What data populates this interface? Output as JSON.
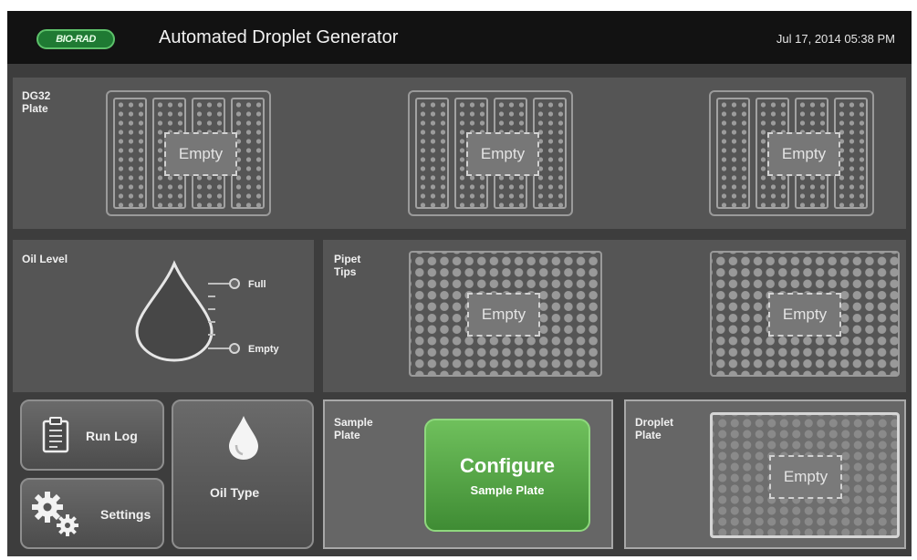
{
  "header": {
    "logo_text": "BIO-RAD",
    "title": "Automated Droplet Generator",
    "datetime": "Jul 17, 2014 05:38 PM"
  },
  "dg32": {
    "label": "DG32\nPlate",
    "cartridges": [
      {
        "status": "Empty"
      },
      {
        "status": "Empty"
      },
      {
        "status": "Empty"
      }
    ]
  },
  "oil_level": {
    "label": "Oil Level",
    "full_label": "Full",
    "empty_label": "Empty"
  },
  "pipet_tips": {
    "label": "Pipet\nTips",
    "boxes": [
      {
        "status": "Empty"
      },
      {
        "status": "Empty"
      }
    ]
  },
  "buttons": {
    "run_log": "Run Log",
    "settings": "Settings",
    "oil_type": "Oil Type"
  },
  "sample_plate": {
    "label": "Sample\nPlate",
    "configure_title": "Configure",
    "configure_subtitle": "Sample Plate"
  },
  "droplet_plate": {
    "label": "Droplet\nPlate",
    "status": "Empty"
  },
  "colors": {
    "header_bg": "#121212",
    "panel_bg": "#555555",
    "configure_green": "#4fa540",
    "logo_green": "#1f7a33"
  }
}
